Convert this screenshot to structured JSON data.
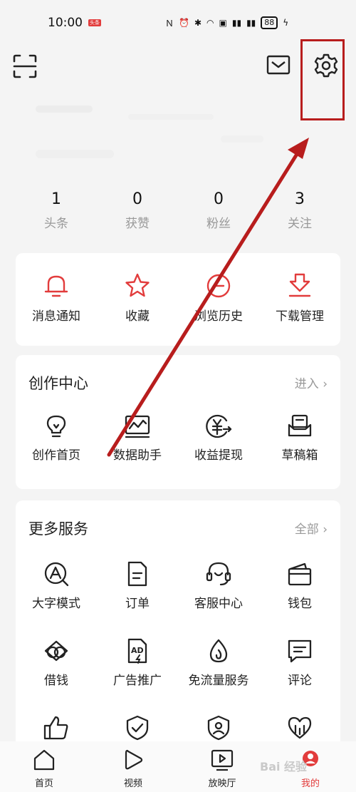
{
  "status_bar": {
    "time": "10:00",
    "badge": "头条",
    "battery": "88"
  },
  "stats": [
    {
      "value": "1",
      "label": "头条"
    },
    {
      "value": "0",
      "label": "获赞"
    },
    {
      "value": "0",
      "label": "粉丝"
    },
    {
      "value": "3",
      "label": "关注"
    }
  ],
  "quick_actions": [
    {
      "label": "消息通知",
      "icon": "bell-icon"
    },
    {
      "label": "收藏",
      "icon": "star-icon"
    },
    {
      "label": "浏览历史",
      "icon": "history-icon"
    },
    {
      "label": "下载管理",
      "icon": "download-icon"
    }
  ],
  "creation_center": {
    "title": "创作中心",
    "link": "进入 ›",
    "items": [
      {
        "label": "创作首页",
        "icon": "lightbulb-icon"
      },
      {
        "label": "数据助手",
        "icon": "chart-icon"
      },
      {
        "label": "收益提现",
        "icon": "yuan-icon"
      },
      {
        "label": "草稿箱",
        "icon": "draft-icon"
      }
    ]
  },
  "more_services": {
    "title": "更多服务",
    "link": "全部 ›",
    "items": [
      {
        "label": "大字模式",
        "icon": "large-font-icon"
      },
      {
        "label": "订单",
        "icon": "order-icon"
      },
      {
        "label": "客服中心",
        "icon": "headset-icon"
      },
      {
        "label": "钱包",
        "icon": "wallet-icon"
      },
      {
        "label": "借钱",
        "icon": "loan-icon"
      },
      {
        "label": "广告推广",
        "icon": "ad-icon"
      },
      {
        "label": "免流量服务",
        "icon": "flame-icon"
      },
      {
        "label": "评论",
        "icon": "comment-icon"
      }
    ]
  },
  "tab_bar": [
    {
      "label": "首页",
      "icon": "home-icon"
    },
    {
      "label": "视频",
      "icon": "play-icon"
    },
    {
      "label": "放映厅",
      "icon": "theater-icon"
    },
    {
      "label": "我的",
      "icon": "profile-icon"
    }
  ],
  "watermark": "Bai 经验",
  "colors": {
    "accent_red": "#e23c3c",
    "annotation_red": "#b81d1d",
    "page_bg": "#f4f4f4",
    "card_bg": "#ffffff"
  }
}
